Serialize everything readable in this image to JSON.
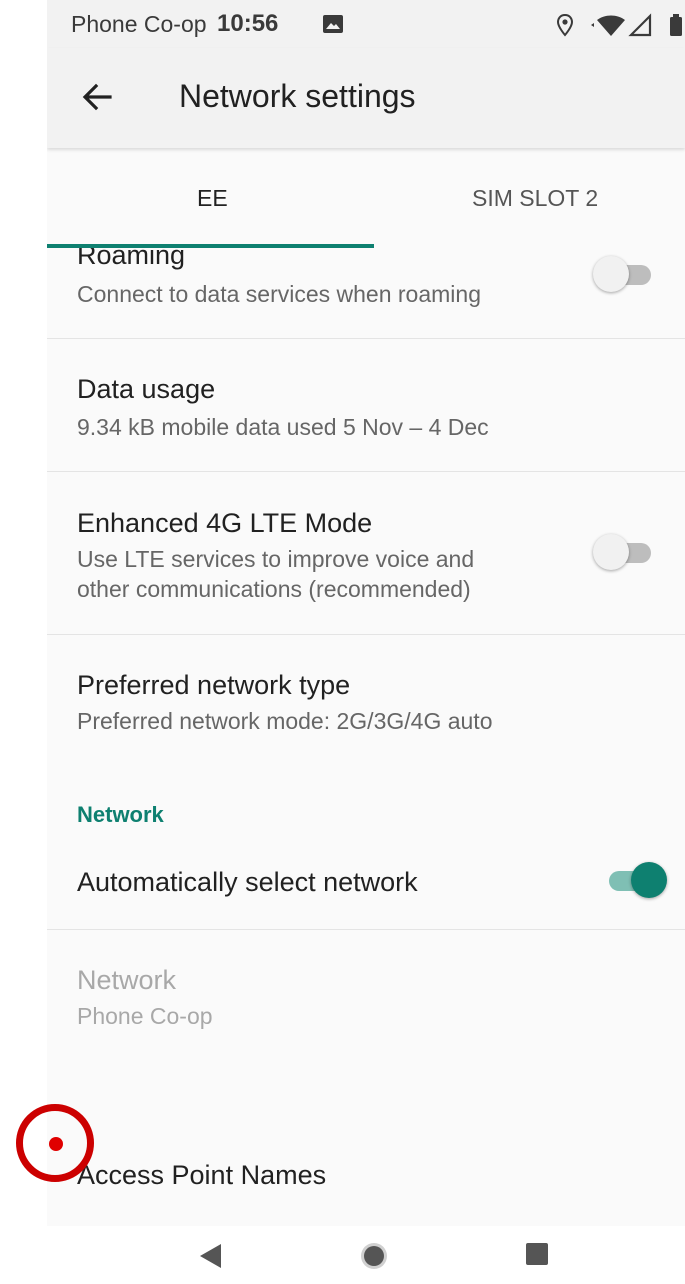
{
  "status_bar": {
    "carrier": "Phone Co-op",
    "time": "10:56"
  },
  "toolbar": {
    "title": "Network settings"
  },
  "tabs": [
    {
      "label": "EE",
      "selected": true
    },
    {
      "label": "SIM SLOT 2",
      "selected": false
    }
  ],
  "settings": {
    "roaming": {
      "title": "Roaming",
      "summary": "Connect to data services when roaming",
      "enabled": false
    },
    "data_usage": {
      "title": "Data usage",
      "summary": "9.34 kB mobile data used 5 Nov – 4 Dec"
    },
    "enhanced_lte": {
      "title": "Enhanced 4G LTE Mode",
      "summary_line1": "Use LTE services to improve voice and",
      "summary_line2": "other communications (recommended)",
      "enabled": false
    },
    "preferred_network": {
      "title": "Preferred network type",
      "summary": "Preferred network mode: 2G/3G/4G auto"
    },
    "network_section_header": "Network",
    "auto_select": {
      "title": "Automatically select network",
      "enabled": true
    },
    "network": {
      "title": "Network",
      "summary": "Phone Co-op"
    },
    "apn": {
      "title": "Access Point Names"
    }
  },
  "colors": {
    "accent": "#0e8070",
    "tap_marker": "#cc0000"
  }
}
